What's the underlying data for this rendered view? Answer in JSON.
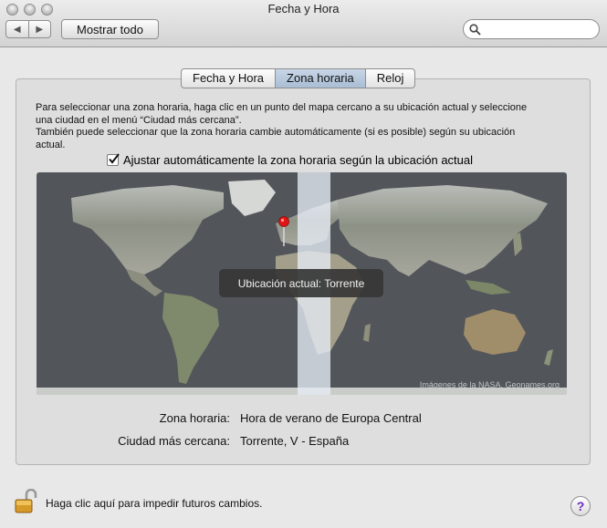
{
  "window": {
    "title": "Fecha y Hora"
  },
  "toolbar": {
    "back_icon": "chevron-left-icon",
    "forward_icon": "chevron-right-icon",
    "show_all_label": "Mostrar todo",
    "search_value": "",
    "search_icon": "magnifier-icon"
  },
  "tabs": [
    {
      "label": "Fecha y Hora",
      "active": false
    },
    {
      "label": "Zona horaria",
      "active": true
    },
    {
      "label": "Reloj",
      "active": false
    }
  ],
  "description": {
    "line1": "Para seleccionar una zona horaria, haga clic en un punto del mapa cercano a su ubicación actual y seleccione",
    "line2": "una ciudad en el menú “Ciudad más cercana”.",
    "line3": "También puede seleccionar que la zona horaria cambie automáticamente (si es posible) según su ubicación",
    "line4": "actual."
  },
  "auto_timezone": {
    "label": "Ajustar automáticamente la zona horaria según la ubicación actual",
    "checked": true
  },
  "map": {
    "current_location_label": "Ubicación actual: Torrente",
    "credit": "Imágenes de la NASA, Geonames.org",
    "pin_icon": "map-pin-icon"
  },
  "details": {
    "timezone_label": "Zona horaria:",
    "timezone_value": "Hora de verano de Europa Central",
    "city_label": "Ciudad más cercana:",
    "city_value": "Torrente, V - España"
  },
  "footer": {
    "lock_text": "Haga clic aquí para impedir futuros cambios.",
    "lock_icon": "padlock-open-icon",
    "help_label": "?"
  },
  "colors": {
    "tab_active": "#b2c4d9",
    "map_background": "#52565b",
    "help_accent": "#6a2bbf"
  }
}
